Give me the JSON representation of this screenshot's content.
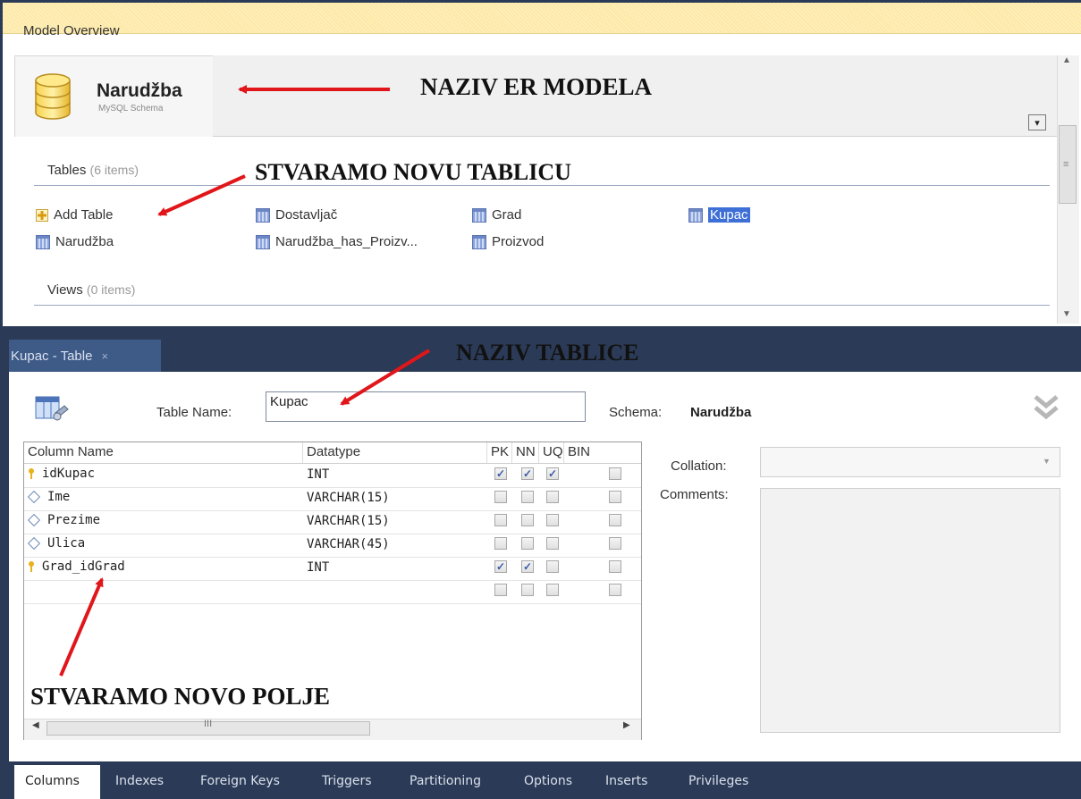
{
  "overview": {
    "title": "Model Overview",
    "schema_name": "Narudžba",
    "schema_type": "MySQL Schema",
    "tables_section": {
      "label": "Tables",
      "count": "(6 items)"
    },
    "views_section": {
      "label": "Views",
      "count": "(0 items)"
    },
    "table_items": [
      {
        "label": "Add Table",
        "icon": "add-table-icon"
      },
      {
        "label": "Dostavljač",
        "icon": "table-icon"
      },
      {
        "label": "Grad",
        "icon": "table-icon"
      },
      {
        "label": "Kupac",
        "icon": "table-icon",
        "selected": true
      },
      {
        "label": "Narudžba",
        "icon": "table-icon"
      },
      {
        "label": "Narudžba_has_Proizv...",
        "icon": "table-icon"
      },
      {
        "label": "Proizvod",
        "icon": "table-icon"
      }
    ],
    "dropdown_icon": "▾"
  },
  "editor": {
    "tab_label": "Kupac - Table",
    "tab_close": "×",
    "table_name_label": "Table Name:",
    "table_name_value": "Kupac",
    "schema_label": "Schema:",
    "schema_value": "Narudžba",
    "collation_label": "Collation:",
    "comments_label": "Comments:",
    "grid": {
      "headers": [
        "Column Name",
        "Datatype",
        "PK",
        "NN",
        "UQ",
        "BIN"
      ],
      "rows": [
        {
          "name": "idKupac",
          "type": "INT",
          "icon": "key-icon",
          "pk": true,
          "nn": true,
          "uq": true,
          "bin": false
        },
        {
          "name": "Ime",
          "type": "VARCHAR(15)",
          "icon": "diamond-icon",
          "pk": false,
          "nn": false,
          "uq": false,
          "bin": false
        },
        {
          "name": "Prezime",
          "type": "VARCHAR(15)",
          "icon": "diamond-icon",
          "pk": false,
          "nn": false,
          "uq": false,
          "bin": false
        },
        {
          "name": "Ulica",
          "type": "VARCHAR(45)",
          "icon": "diamond-icon",
          "pk": false,
          "nn": false,
          "uq": false,
          "bin": false
        },
        {
          "name": "Grad_idGrad",
          "type": "INT",
          "icon": "key-icon",
          "pk": true,
          "nn": true,
          "uq": false,
          "bin": false
        },
        {
          "name": "",
          "type": "",
          "icon": "",
          "pk": false,
          "nn": false,
          "uq": false,
          "bin": false
        }
      ],
      "hscroll_grip": "III"
    },
    "bottom_tabs": [
      "Columns",
      "Indexes",
      "Foreign Keys",
      "Triggers",
      "Partitioning",
      "Options",
      "Inserts",
      "Privileges"
    ],
    "active_tab": "Columns"
  },
  "annotations": {
    "model_name": "NAZIV ER MODELA",
    "new_table": "STVARAMO NOVU TABLICU",
    "table_name": "NAZIV TABLICE",
    "new_field": "STVARAMO NOVO POLJE"
  },
  "colors": {
    "frame": "#2b3a56",
    "header_yellow": "#fde9a6",
    "selection": "#3d6fd6",
    "arrow": "#e0161b"
  }
}
